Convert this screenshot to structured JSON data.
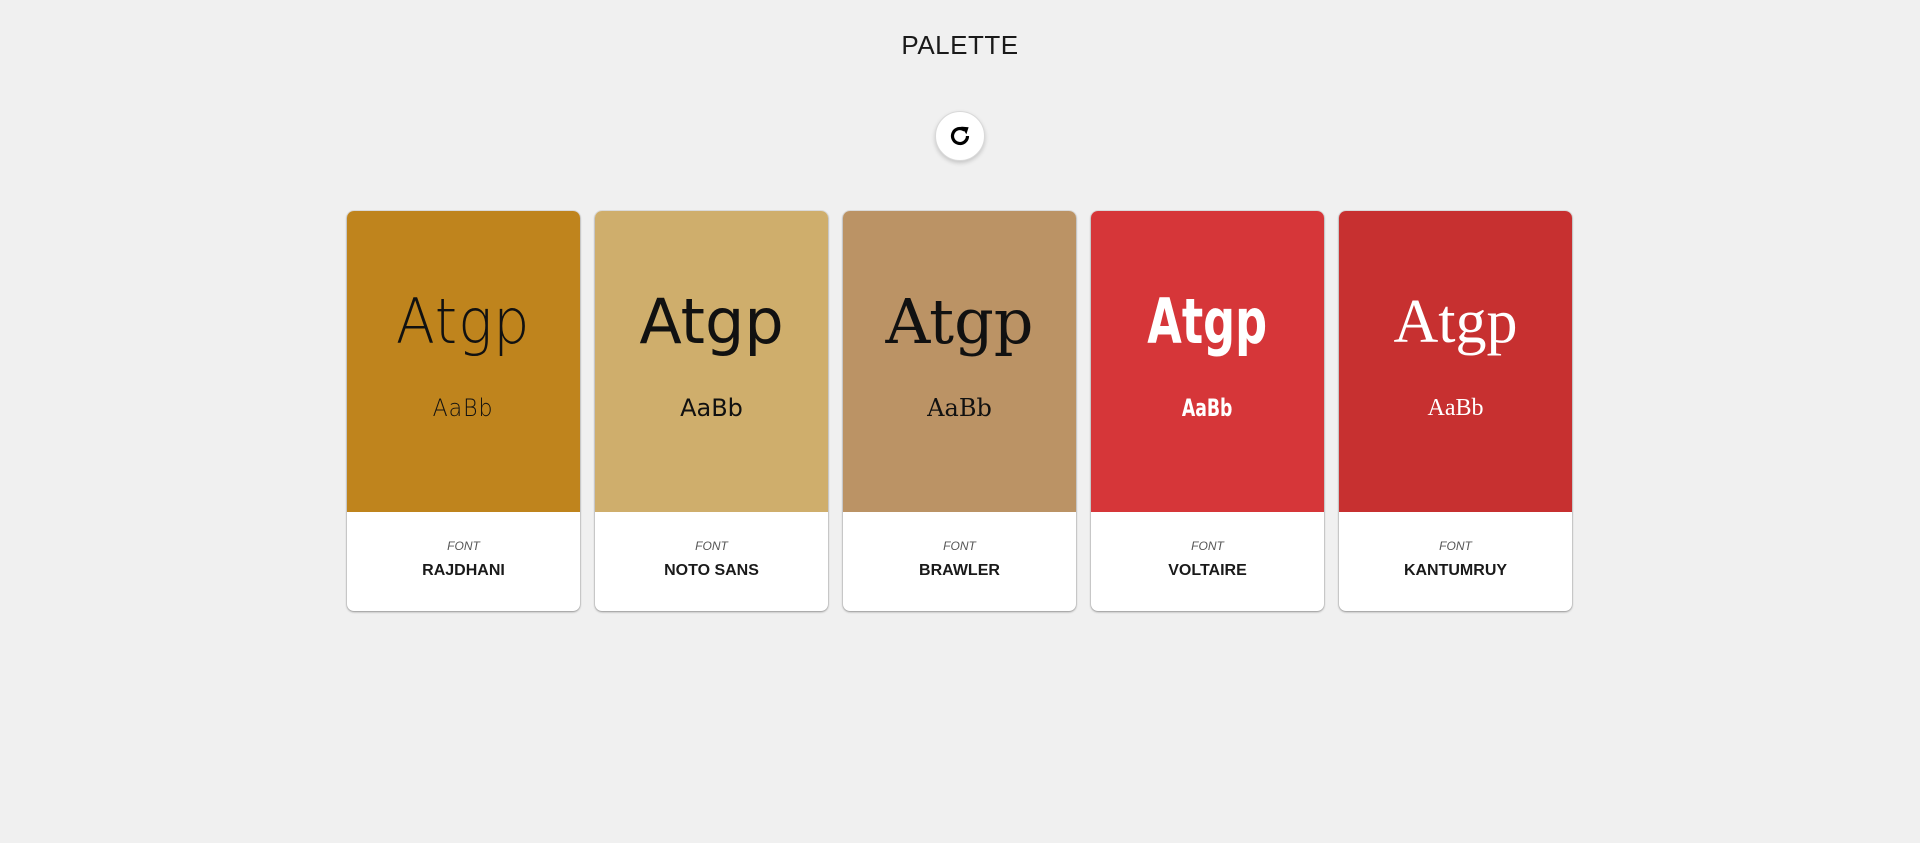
{
  "page": {
    "title": "PALETTE",
    "background": "#f0f0f0"
  },
  "refresh": {
    "icon": "refresh-icon"
  },
  "cards": [
    {
      "color": "#bf841d",
      "text_color": "#111111",
      "sample_large": "Atgp",
      "sample_small": "AaBb",
      "label": "FONT",
      "font_name": "RAJDHANI"
    },
    {
      "color": "#cfae6c",
      "text_color": "#111111",
      "sample_large": "Atgp",
      "sample_small": "AaBb",
      "label": "FONT",
      "font_name": "NOTO SANS"
    },
    {
      "color": "#bb9365",
      "text_color": "#111111",
      "sample_large": "Atgp",
      "sample_small": "AaBb",
      "label": "FONT",
      "font_name": "BRAWLER"
    },
    {
      "color": "#d63639",
      "text_color": "#ffffff",
      "sample_large": "Atgp",
      "sample_small": "AaBb",
      "label": "FONT",
      "font_name": "VOLTAIRE"
    },
    {
      "color": "#c73030",
      "text_color": "#ffffff",
      "sample_large": "Atgp",
      "sample_small": "AaBb",
      "label": "FONT",
      "font_name": "KANTUMRUY"
    }
  ]
}
